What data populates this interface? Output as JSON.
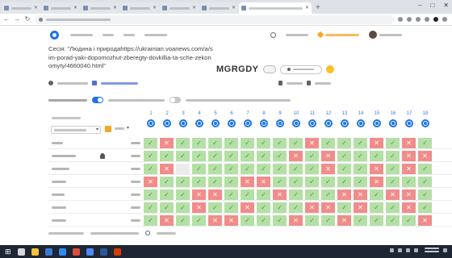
{
  "browser": {
    "tab_count": 7,
    "active_tab_index": 6
  },
  "session": {
    "title": "Сесія: \"Людина і природаhttps://ukrainian.voanews.com/a/sim-porad-yaki-dopomozhut-zberegty-dovkillia-ta-sche-zekonomyty/4660040.html\"",
    "code": "MGRGDY"
  },
  "results": {
    "column_numbers": [
      "1",
      "2",
      "3",
      "4",
      "5",
      "6",
      "7",
      "8",
      "9",
      "10",
      "11",
      "12",
      "13",
      "14",
      "15",
      "16",
      "17",
      "18"
    ],
    "rows": [
      {
        "cells": [
          "ok",
          "bad",
          "ok",
          "ok",
          "ok",
          "ok",
          "ok",
          "ok",
          "ok",
          "ok",
          "bad",
          "ok",
          "ok",
          "ok",
          "bad",
          "ok",
          "bad",
          "ok"
        ]
      },
      {
        "flag": true,
        "cells": [
          "ok",
          "ok",
          "ok",
          "ok",
          "ok",
          "ok",
          "ok",
          "ok",
          "ok",
          "bad",
          "ok",
          "bad",
          "ok",
          "ok",
          "ok",
          "ok",
          "bad",
          "bad"
        ]
      },
      {
        "cells": [
          "ok",
          "bad",
          "none",
          "ok",
          "ok",
          "ok",
          "ok",
          "ok",
          "ok",
          "ok",
          "ok",
          "bad",
          "ok",
          "ok",
          "bad",
          "ok",
          "bad",
          "ok"
        ]
      },
      {
        "cells": [
          "bad",
          "ok",
          "ok",
          "ok",
          "ok",
          "ok",
          "bad",
          "bad",
          "ok",
          "ok",
          "ok",
          "ok",
          "ok",
          "ok",
          "bad",
          "ok",
          "ok",
          "ok"
        ]
      },
      {
        "cells": [
          "ok",
          "ok",
          "ok",
          "bad",
          "bad",
          "ok",
          "ok",
          "ok",
          "bad",
          "ok",
          "ok",
          "ok",
          "bad",
          "bad",
          "ok",
          "bad",
          "bad",
          "ok"
        ]
      },
      {
        "cells": [
          "ok",
          "ok",
          "ok",
          "bad",
          "ok",
          "ok",
          "bad",
          "ok",
          "ok",
          "ok",
          "bad",
          "bad",
          "ok",
          "bad",
          "ok",
          "ok",
          "bad",
          "ok"
        ]
      },
      {
        "cells": [
          "ok",
          "bad",
          "ok",
          "ok",
          "bad",
          "bad",
          "ok",
          "ok",
          "ok",
          "bad",
          "ok",
          "ok",
          "bad",
          "ok",
          "ok",
          "ok",
          "ok",
          "bad"
        ]
      }
    ]
  },
  "icons": {
    "ok": "check-icon",
    "bad": "cross-icon",
    "question_type": "radio-question-icon",
    "flag": "trophy-icon"
  },
  "colors": {
    "correct": "#b4dfa5",
    "incorrect": "#f08d8b",
    "unanswered": "#ececec",
    "accent": "#1a73e8",
    "column_number": "#4a6ee0",
    "upgrade": "#f6a623"
  }
}
